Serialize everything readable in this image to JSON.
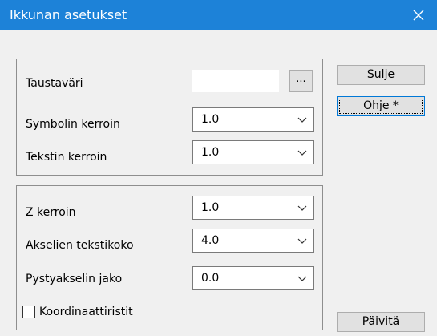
{
  "window": {
    "title": "Ikkunan asetukset"
  },
  "group_top": {
    "background_color_label": "Taustaväri",
    "ellipsis_label": "...",
    "symbol_factor_label": "Symbolin kerroin",
    "symbol_factor_value": "1.0",
    "text_factor_label": "Tekstin kerroin",
    "text_factor_value": "1.0"
  },
  "group_bottom": {
    "z_factor_label": "Z kerroin",
    "z_factor_value": "1.0",
    "axis_text_size_label": "Akselien tekstikoko",
    "axis_text_size_value": "4.0",
    "vertical_axis_division_label": "Pystyakselin jako",
    "vertical_axis_division_value": "0.0",
    "coordinate_crosses_label": "Koordinaattiristit",
    "coordinate_crosses_checked": false
  },
  "buttons": {
    "close_label": "Sulje",
    "help_label": "Ohje *",
    "update_label": "Päivitä"
  },
  "colors": {
    "titlebar": "#1d82d8",
    "focus_border": "#0078d7"
  },
  "icons": {
    "close": "close-icon",
    "dropdown": "chevron-down-icon"
  }
}
